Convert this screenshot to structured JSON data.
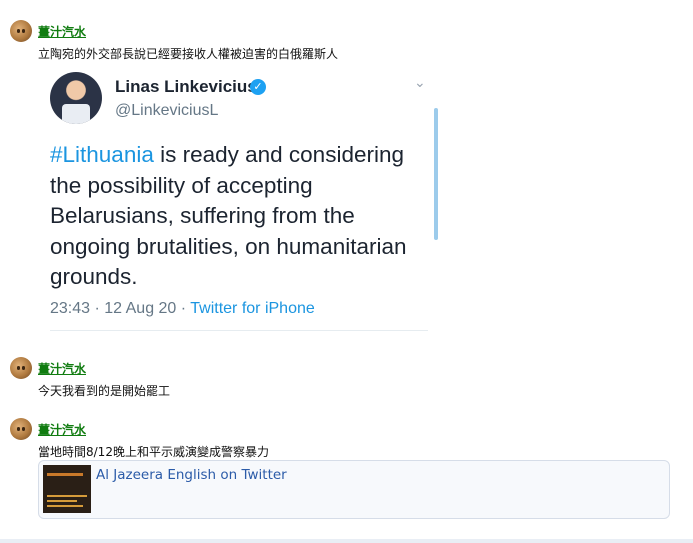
{
  "posts": [
    {
      "username": "薑汁汽水",
      "message": "立陶宛的外交部長說已經要接收人權被迫害的白俄羅斯人",
      "tweet": {
        "display_name": "Linas Linkevicius",
        "handle": "@LinkeviciusL",
        "hashtag": "#Lithuania",
        "text": " is ready and considering the possibility of accepting Belarusians, suffering from the ongoing brutalities, on humanitarian grounds.",
        "timestamp": "23:43 · 12 Aug 20 · ",
        "source": "Twitter for iPhone"
      }
    },
    {
      "username": "薑汁汽水",
      "message": "今天我看到的是開始罷工"
    },
    {
      "username": "薑汁汽水",
      "message": "當地時間8/12晚上和平示威演變成警察暴力",
      "link_card": {
        "title": "Al Jazeera English on Twitter"
      }
    }
  ],
  "colors": {
    "username": "#107c10",
    "twitter_blue": "#1b95e0",
    "card_link": "#2b5ba8"
  }
}
